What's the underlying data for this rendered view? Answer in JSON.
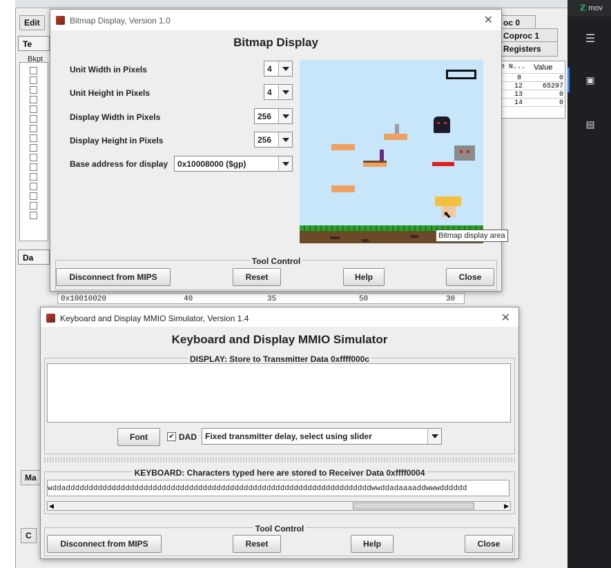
{
  "background": {
    "tabs": {
      "edit": "Edit",
      "coproc0": "oc 0",
      "coproc1": "Coproc 1",
      "registers": "Registers",
      "te": "Te",
      "da": "Da",
      "ma": "Ma",
      "c": "C"
    },
    "bkpt_header": "Bkpt",
    "reg_table": {
      "headers": {
        "num": "N...",
        "value": "Value",
        "e": "e"
      },
      "rows": [
        {
          "num": "8",
          "value": "0"
        },
        {
          "num": "12",
          "value": "65297"
        },
        {
          "num": "13",
          "value": "0"
        },
        {
          "num": "14",
          "value": "0"
        }
      ]
    },
    "memory_row": {
      "address": "0x10010020",
      "v1": "40",
      "v2": "35",
      "v3": "50",
      "v4": "30"
    },
    "sidebar_top_text": "mov"
  },
  "bitmap_dialog": {
    "window_title": "Bitmap Display, Version 1.0",
    "heading": "Bitmap Display",
    "settings": [
      {
        "label": "Unit Width in Pixels",
        "value": "4"
      },
      {
        "label": "Unit Height in Pixels",
        "value": "4"
      },
      {
        "label": "Display Width in Pixels",
        "value": "256"
      },
      {
        "label": "Display Height in Pixels",
        "value": "256"
      },
      {
        "label": "Base address for display",
        "value": "0x10008000 ($gp)"
      }
    ],
    "tooltip": "Bitmap display area",
    "tool_control_title": "Tool Control",
    "buttons": {
      "disconnect": "Disconnect from MIPS",
      "reset": "Reset",
      "help": "Help",
      "close": "Close"
    }
  },
  "mmio_dialog": {
    "window_title": "Keyboard and Display MMIO Simulator, Version 1.4",
    "heading": "Keyboard and Display MMIO Simulator",
    "display_group_title": "DISPLAY: Store to Transmitter Data 0xffff000c",
    "font_button": "Font",
    "dad_label": "DAD",
    "dad_checked": true,
    "delay_select": "Fixed transmitter delay, select using slider",
    "keyboard_group_title": "KEYBOARD: Characters typed here are stored to Receiver Data 0xffff0004",
    "keyboard_text": "wddadddddddddddddddddddddddddddddddddddddddddddddddddddddddddddddddddddwwddadaaaaddwwwdddddd",
    "tool_control_title": "Tool Control",
    "buttons": {
      "disconnect": "Disconnect from MIPS",
      "reset": "Reset",
      "help": "Help",
      "close": "Close"
    }
  },
  "colors": {
    "sky": "#c8e6fa",
    "platform": "#f0a060",
    "grass": "#2aa12a",
    "dirt": "#6b4a2a",
    "sidebar_dark": "#1e1f22",
    "accent": "#3b82f6"
  }
}
